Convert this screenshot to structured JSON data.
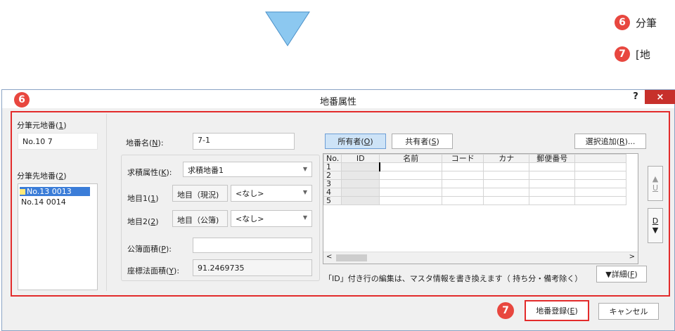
{
  "steps": [
    {
      "num": "6",
      "text": "分筆"
    },
    {
      "num": "7",
      "text": "[地"
    }
  ],
  "dialog": {
    "badge": "6",
    "title": "地番属性",
    "help": "?",
    "close": "×"
  },
  "source": {
    "label_pre": "分筆元地番(",
    "label_key": "1",
    "label_post": ")",
    "value": "No.10 7"
  },
  "dest": {
    "label_pre": "分筆先地番(",
    "label_key": "2",
    "label_post": ")",
    "items": [
      {
        "text": "No.13 0013",
        "selected": true
      },
      {
        "text": "No.14 0014",
        "selected": false
      }
    ]
  },
  "form": {
    "name_pre": "地番名(",
    "name_key": "N",
    "name_post": "):",
    "name_value": "7-1",
    "attr_pre": "求積属性(",
    "attr_key": "K",
    "attr_post": "):",
    "attr_value": "求積地番1",
    "chimoku1_pre": "地目1(",
    "chimoku1_key": "1",
    "chimoku1_post": ")",
    "chimoku1_tag": "地目（現況)",
    "chimoku1_value": "<なし>",
    "chimoku2_pre": "地目2(",
    "chimoku2_key": "2",
    "chimoku2_post": ")",
    "chimoku2_tag": "地目（公簿)",
    "chimoku2_value": "<なし>",
    "kobo_pre": "公簿面積(",
    "kobo_key": "P",
    "kobo_post": "):",
    "kobo_value": "",
    "zahyo_pre": "座標法面積(",
    "zahyo_key": "Y",
    "zahyo_post": "):",
    "zahyo_value": "91.2469735"
  },
  "owners": {
    "tab_owner_pre": "所有者(",
    "tab_owner_key": "O",
    "tab_owner_post": ")",
    "tab_co_pre": "共有者(",
    "tab_co_key": "S",
    "tab_co_post": ")",
    "add_pre": "選択追加(",
    "add_key": "R",
    "add_post": ")...",
    "columns": [
      "No.",
      "ID",
      "名前",
      "コード",
      "カナ",
      "郵便番号"
    ],
    "rows": [
      "1",
      "2",
      "3",
      "4",
      "5"
    ],
    "up_key": "U",
    "down_key": "D",
    "note": "「ID」付き行の編集は、マスタ情報を書き換えます（ 持ち分・備考除く）",
    "detail_pre": "▼詳細(",
    "detail_key": "F",
    "detail_post": ")"
  },
  "footer": {
    "badge": "7",
    "register_pre": "地番登録(",
    "register_key": "E",
    "register_post": ")",
    "cancel": "キャンセル"
  },
  "colors": {
    "accent_red": "#e32b2b",
    "badge_red": "#e8473f",
    "arrow_blue": "#7fbde8",
    "selection": "#3b7dd8"
  }
}
